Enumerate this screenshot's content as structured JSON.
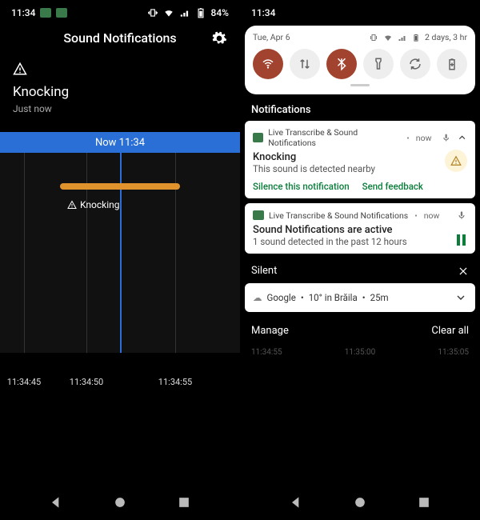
{
  "left": {
    "status": {
      "time": "11:34",
      "battery": "84%"
    },
    "title": "Sound Notifications",
    "alert": {
      "name": "Knocking",
      "when": "Just now"
    },
    "nowbar": "Now 11:34",
    "event_label": "Knocking",
    "axis": {
      "t1": "11:34:45",
      "t2": "11:34:50",
      "t3": "11:34:55"
    }
  },
  "right": {
    "status": {
      "time": "11:34"
    },
    "qs": {
      "date": "Tue, Apr 6",
      "battery": "2 days, 3 hr"
    },
    "notifications_label": "Notifications",
    "n1": {
      "app": "Live Transcribe & Sound Notifications",
      "time": "now",
      "title": "Knocking",
      "body": "This sound is detected nearby",
      "action1": "Silence this notification",
      "action2": "Send feedback"
    },
    "n2": {
      "app": "Live Transcribe & Sound Notifications",
      "time": "now",
      "title": "Sound Notifications are active",
      "body": "1 sound detected in the past 12 hours"
    },
    "silent_label": "Silent",
    "google": {
      "app": "Google",
      "weather": "10° in Brăila",
      "age": "25m"
    },
    "footer": {
      "manage": "Manage",
      "clear": "Clear all"
    },
    "ghost": {
      "t1": "11:34:55",
      "t2": "11:35:00",
      "t3": "11:35:05"
    }
  }
}
